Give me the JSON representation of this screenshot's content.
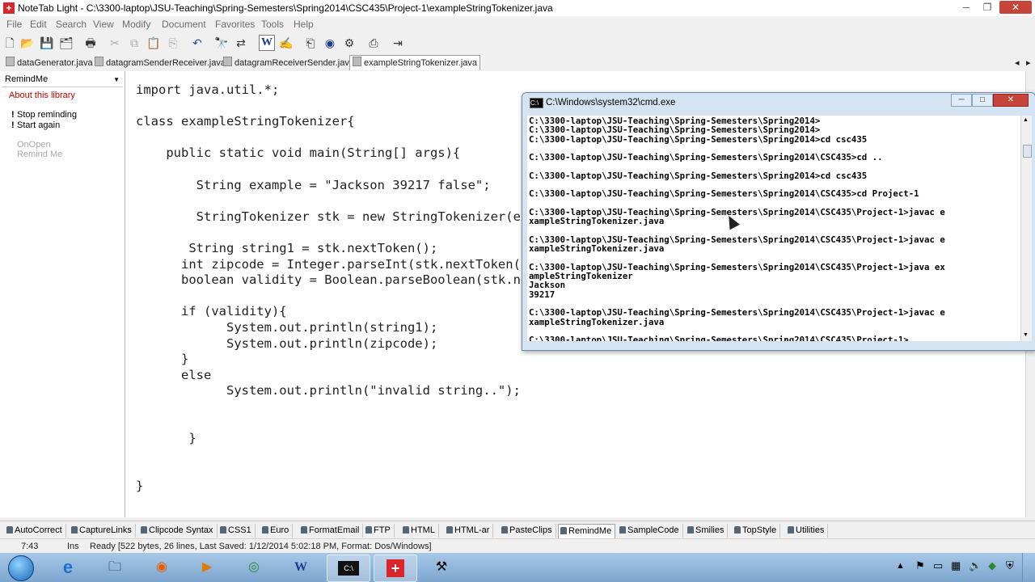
{
  "window": {
    "title": "NoteTab Light  -  C:\\3300-laptop\\JSU-Teaching\\Spring-Semesters\\Spring2014\\CSC435\\Project-1\\exampleStringTokenizer.java",
    "minimize": "─",
    "maximize": "❐",
    "close": "✕"
  },
  "menu": [
    "File",
    "Edit",
    "Search",
    "View",
    "Modify",
    "Document",
    "Favorites",
    "Tools",
    "Help"
  ],
  "toolbar": {
    "icons": [
      "new-file-icon",
      "open-icon",
      "save-icon",
      "save-all-icon",
      "print-icon",
      "cut-icon",
      "copy-icon",
      "paste-icon",
      "clipboard-icon",
      "undo-icon",
      "find-icon",
      "replace-icon",
      "word-icon",
      "spell-icon",
      "copy-doc-icon",
      "browser-icon",
      "settings-icon",
      "clip-icon",
      "exit-icon"
    ],
    "word_label": "W"
  },
  "tabs": [
    "dataGenerator.java",
    "datagramSenderReceiver.java",
    "datagramReceiverSender.java",
    "exampleStringTokenizer.java"
  ],
  "tab_scroll": {
    "left": "◂",
    "right": "▸"
  },
  "library": {
    "selected": "RemindMe",
    "about": "About this library",
    "items": [
      "Stop reminding",
      "Start again"
    ],
    "disabled_items": [
      "OnOpen",
      "Remind Me"
    ],
    "bullet": "!"
  },
  "editor": {
    "lines": [
      "import java.util.*;",
      "",
      "class exampleStringTokenizer{",
      "",
      "    public static void main(String[] args){",
      "",
      "        String example = \"Jackson 39217 false\";",
      "",
      "        StringTokenizer stk = new StringTokenizer(example);",
      "",
      "       String string1 = stk.nextToken();",
      "      int zipcode = Integer.parseInt(stk.nextToken());",
      "      boolean validity = Boolean.parseBoolean(stk.nextToken());",
      "",
      "      if (validity){",
      "            System.out.println(string1);",
      "            System.out.println(zipcode);",
      "      }",
      "      else",
      "            System.out.println(\"invalid string..\");",
      "",
      "",
      "       }",
      "",
      "",
      "}"
    ]
  },
  "cmd": {
    "title": "C:\\Windows\\system32\\cmd.exe",
    "icon_text": "C:\\",
    "lines": [
      "C:\\3300-laptop\\JSU-Teaching\\Spring-Semesters\\Spring2014>",
      "C:\\3300-laptop\\JSU-Teaching\\Spring-Semesters\\Spring2014>",
      "C:\\3300-laptop\\JSU-Teaching\\Spring-Semesters\\Spring2014>cd csc435",
      "",
      "C:\\3300-laptop\\JSU-Teaching\\Spring-Semesters\\Spring2014\\CSC435>cd ..",
      "",
      "C:\\3300-laptop\\JSU-Teaching\\Spring-Semesters\\Spring2014>cd csc435",
      "",
      "C:\\3300-laptop\\JSU-Teaching\\Spring-Semesters\\Spring2014\\CSC435>cd Project-1",
      "",
      "C:\\3300-laptop\\JSU-Teaching\\Spring-Semesters\\Spring2014\\CSC435\\Project-1>javac e",
      "xampleStringTokenizer.java",
      "",
      "C:\\3300-laptop\\JSU-Teaching\\Spring-Semesters\\Spring2014\\CSC435\\Project-1>javac e",
      "xampleStringTokenizer.java",
      "",
      "C:\\3300-laptop\\JSU-Teaching\\Spring-Semesters\\Spring2014\\CSC435\\Project-1>java ex",
      "ampleStringTokenizer",
      "Jackson",
      "39217",
      "",
      "C:\\3300-laptop\\JSU-Teaching\\Spring-Semesters\\Spring2014\\CSC435\\Project-1>javac e",
      "xampleStringTokenizer.java",
      "",
      "C:\\3300-laptop\\JSU-Teaching\\Spring-Semesters\\Spring2014\\CSC435\\Project-1>"
    ],
    "minimize": "─",
    "maximize": "□",
    "close": "✕"
  },
  "clipbooks": [
    "AutoCorrect",
    "CaptureLinks",
    "Clipcode Syntax",
    "CSS1",
    "Euro",
    "FormatEmail",
    "FTP",
    "HTML",
    "HTML-ar",
    "PasteClips",
    "RemindMe",
    "SampleCode",
    "Smilies",
    "TopStyle",
    "Utilities"
  ],
  "clipbooks_active": "RemindMe",
  "status": {
    "position": "7:43",
    "mode": "Ins",
    "info": "Ready  [522 bytes, 26 lines, Last Saved: 1/12/2014 5:02:18 PM, Format: Dos/Windows]"
  },
  "taskbar": {
    "apps": [
      "ie-icon",
      "file-explorer-icon",
      "firefox-icon",
      "media-player-icon",
      "chrome-icon",
      "word-icon",
      "cmd-icon",
      "notetab-icon",
      "tool-icon"
    ],
    "tray_icons": [
      "up-arrow-icon",
      "flag-icon",
      "device-icon",
      "network-icon",
      "volume-icon",
      "update-icon",
      "safety-icon",
      "action-center-icon"
    ]
  },
  "colors": {
    "link": "#cc0000",
    "disabled": "#aaaaaa",
    "close_button": "#c7443a"
  }
}
